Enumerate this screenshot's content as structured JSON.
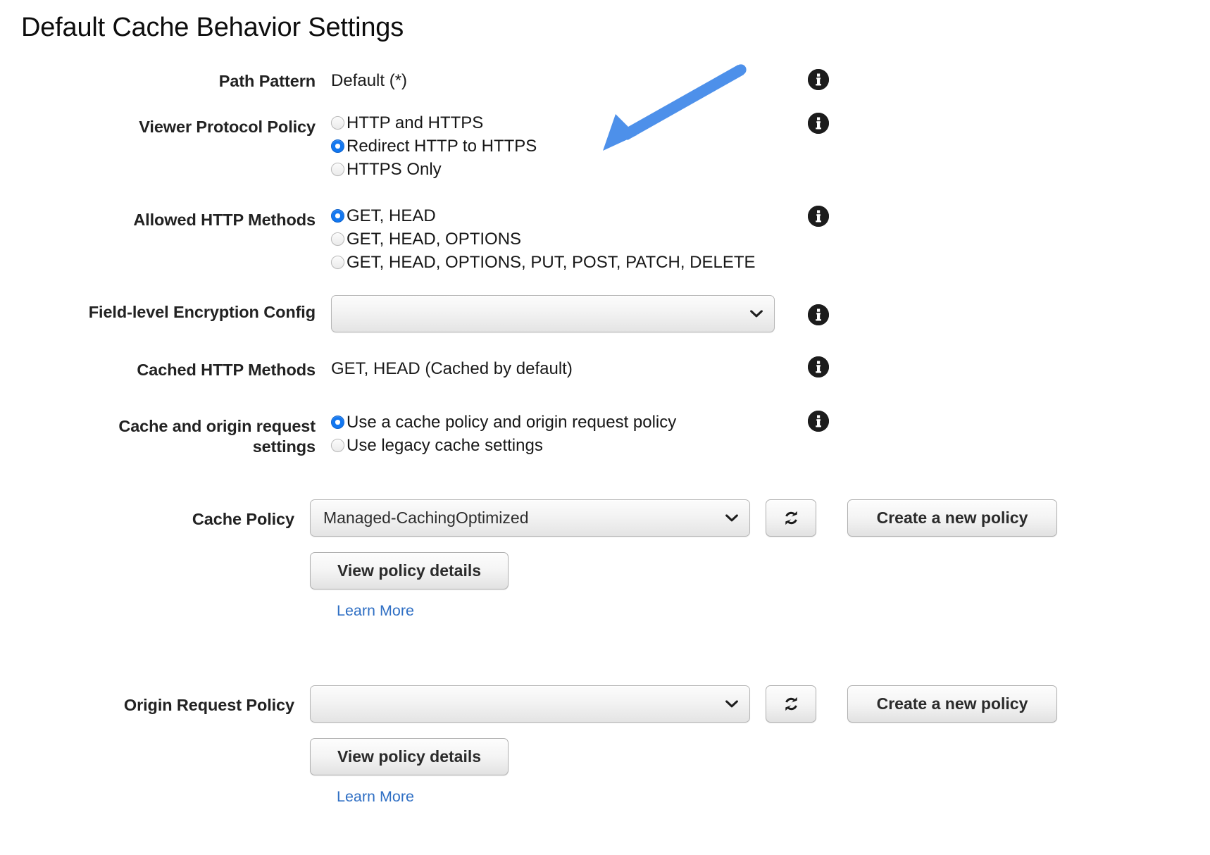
{
  "page": {
    "title": "Default Cache Behavior Settings"
  },
  "fields": {
    "path_pattern": {
      "label": "Path Pattern",
      "value": "Default (*)"
    },
    "viewer_protocol_policy": {
      "label": "Viewer Protocol Policy",
      "options": [
        {
          "label": "HTTP and HTTPS",
          "selected": false
        },
        {
          "label": "Redirect HTTP to HTTPS",
          "selected": true
        },
        {
          "label": "HTTPS Only",
          "selected": false
        }
      ]
    },
    "allowed_http_methods": {
      "label": "Allowed HTTP Methods",
      "options": [
        {
          "label": "GET, HEAD",
          "selected": true
        },
        {
          "label": "GET, HEAD, OPTIONS",
          "selected": false
        },
        {
          "label": "GET, HEAD, OPTIONS, PUT, POST, PATCH, DELETE",
          "selected": false
        }
      ]
    },
    "field_level_encryption_config": {
      "label": "Field-level Encryption Config",
      "value": ""
    },
    "cached_http_methods": {
      "label": "Cached HTTP Methods",
      "value": "GET, HEAD (Cached by default)"
    },
    "cache_and_origin_request_settings": {
      "label": "Cache and origin request settings",
      "label_line1": "Cache and origin request",
      "label_line2": "settings",
      "options": [
        {
          "label": "Use a cache policy and origin request policy",
          "selected": true
        },
        {
          "label": "Use legacy cache settings",
          "selected": false
        }
      ]
    },
    "cache_policy": {
      "label": "Cache Policy",
      "value": "Managed-CachingOptimized",
      "refresh_icon": "refresh-icon",
      "create_button": "Create a new policy",
      "details_button": "View policy details",
      "learn_more": "Learn More"
    },
    "origin_request_policy": {
      "label": "Origin Request Policy",
      "value": "",
      "refresh_icon": "refresh-icon",
      "create_button": "Create a new policy",
      "details_button": "View policy details",
      "learn_more": "Learn More"
    }
  },
  "info_icons": {
    "glyph": "i",
    "name": "info-icon"
  },
  "annotation": {
    "type": "arrow",
    "color": "#4d90ea",
    "points_to": "Redirect HTTP to HTTPS"
  },
  "colors": {
    "accent_radio": "#1277f0",
    "link": "#2f6fc4",
    "arrow": "#4d90ea",
    "info_icon_bg": "#1c1c1c",
    "page_background": "#ffffff",
    "text": "#111111"
  }
}
